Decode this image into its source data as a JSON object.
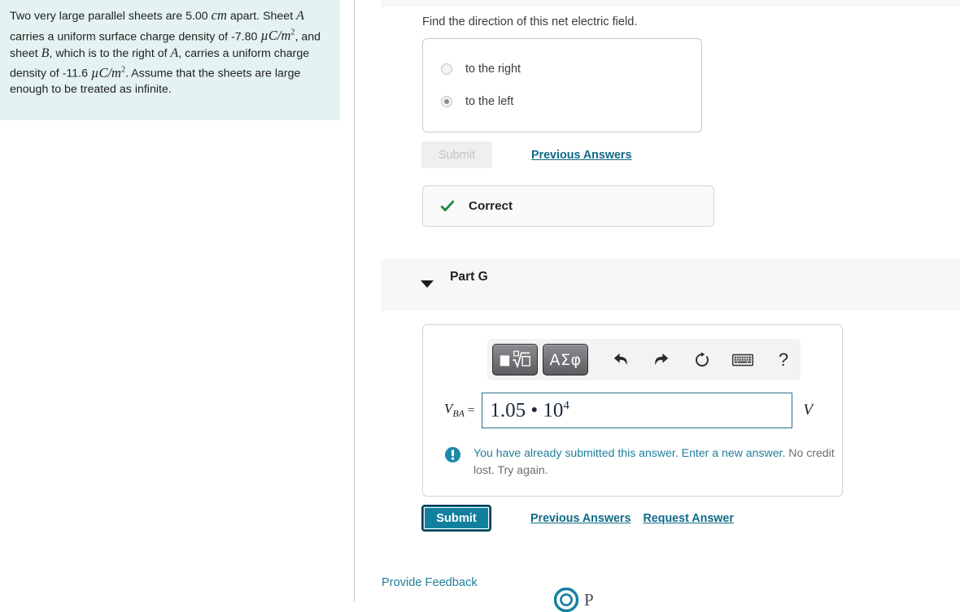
{
  "problem": {
    "line1_pre": "Two very large parallel sheets are 5.00 ",
    "unit_cm": "cm",
    "line1_post": " apart.",
    "line2_pre": "Sheet ",
    "sheet_a": "A",
    "line2_post": " carries a uniform surface charge density of",
    "sigma_a_value": "-7.80",
    "sigma_unit": "µC/m",
    "sigma_exp": "2",
    "line3_mid": ", and sheet ",
    "sheet_b": "B",
    "line3_post": ", which is to the right of",
    "line4_a": "A",
    "line4_post": ", carries a uniform charge density of",
    "sigma_b_value": "-11.6",
    "line5_post": ". Assume that the sheets are large",
    "line6": "enough to be treated as infinite."
  },
  "part_f": {
    "prompt": "Find the direction of this net electric field.",
    "options": [
      {
        "label": "to the right",
        "selected": false
      },
      {
        "label": "to the left",
        "selected": true
      }
    ],
    "submit_label": "Submit",
    "previous_answers_label": "Previous Answers",
    "feedback_status": "Correct",
    "feedback_icon": "check-icon"
  },
  "part_g": {
    "title": "Part G",
    "caret_icon": "chevron-down-icon",
    "toolbar": {
      "template_button_icon": "math-template-icon",
      "greek_button_label": "ΑΣφ",
      "undo_icon": "undo-arrow-icon",
      "redo_icon": "redo-arrow-icon",
      "reset_icon": "reset-circular-arrow-icon",
      "keyboard_icon": "keyboard-icon",
      "help_label": "?"
    },
    "variable_name": "V",
    "variable_subscript": "BA",
    "equals": "=",
    "answer_value_mantissa": "1.05 • 10",
    "answer_value_exponent": "4",
    "unit": "V",
    "warning_icon": "exclamation-circle-icon",
    "warning_line1": "You have already submitted this answer. Enter a new answer.",
    "warning_line2": "No credit lost. Try again.",
    "submit_label": "Submit",
    "previous_answers_label": "Previous Answers",
    "request_answer_label": "Request Answer"
  },
  "footer": {
    "provide_feedback_label": "Provide Feedback",
    "brand_logo_icon": "pearson-logo-icon",
    "brand_text": "P"
  },
  "colors": {
    "problem_panel_bg": "#e4f3f1",
    "link": "#106a87",
    "submit_active_bg": "#11809f",
    "correct_check": "#1a8a3c",
    "warning_teal": "#1f7f9c",
    "input_border": "#2c6e8a",
    "divider": "#b9cfd6"
  }
}
